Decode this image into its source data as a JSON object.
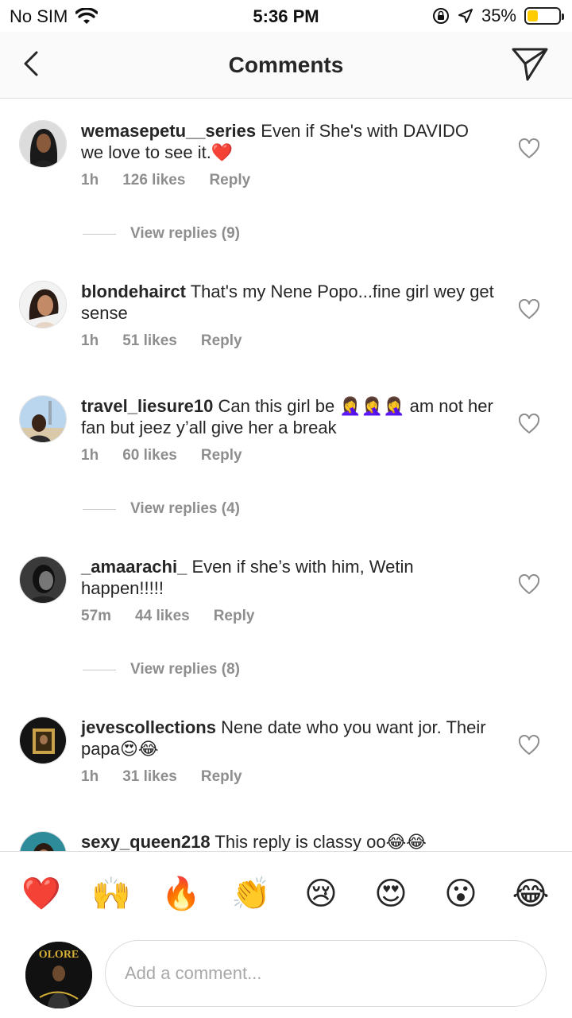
{
  "status": {
    "carrier": "No SIM",
    "time": "5:36 PM",
    "battery": "35%",
    "battery_level": 0.35,
    "battery_color": "#ffcc00"
  },
  "header": {
    "title": "Comments"
  },
  "comments": [
    {
      "username": "wemasepetu__series",
      "text": "Even if She's with DAVIDO we love to see it.❤️",
      "time": "1h",
      "likes": "126 likes",
      "reply": "Reply",
      "view_replies": "View replies (9)"
    },
    {
      "username": "blondehairct",
      "text": "That's my Nene Popo...fine girl wey get sense",
      "time": "1h",
      "likes": "51 likes",
      "reply": "Reply"
    },
    {
      "username": "travel_liesure10",
      "text": "Can this girl be 🤦‍♀️🤦‍♀️🤦‍♀️ am not her fan but jeez y’all give her a break",
      "time": "1h",
      "likes": "60 likes",
      "reply": "Reply",
      "view_replies": "View replies (4)"
    },
    {
      "username": "_amaarachi_",
      "text": "Even if she’s with him, Wetin happen!!!!!",
      "time": "57m",
      "likes": "44 likes",
      "reply": "Reply",
      "view_replies": "View replies (8)"
    },
    {
      "username": "jevescollections",
      "text": "Nene date who you want jor. Their papa😍😂",
      "time": "1h",
      "likes": "31 likes",
      "reply": "Reply"
    },
    {
      "username": "sexy_queen218",
      "text": "This reply is classy oo😂😂"
    }
  ],
  "emoji_bar": [
    "❤️",
    "🙌",
    "🔥",
    "👏",
    "😢",
    "😍",
    "😮",
    "😂"
  ],
  "input": {
    "placeholder": "Add a comment...",
    "avatar_text": "OLORE"
  },
  "colors": {
    "heart_red": "#ed4956",
    "meta_gray": "#8e8e8e",
    "text": "#262626"
  }
}
